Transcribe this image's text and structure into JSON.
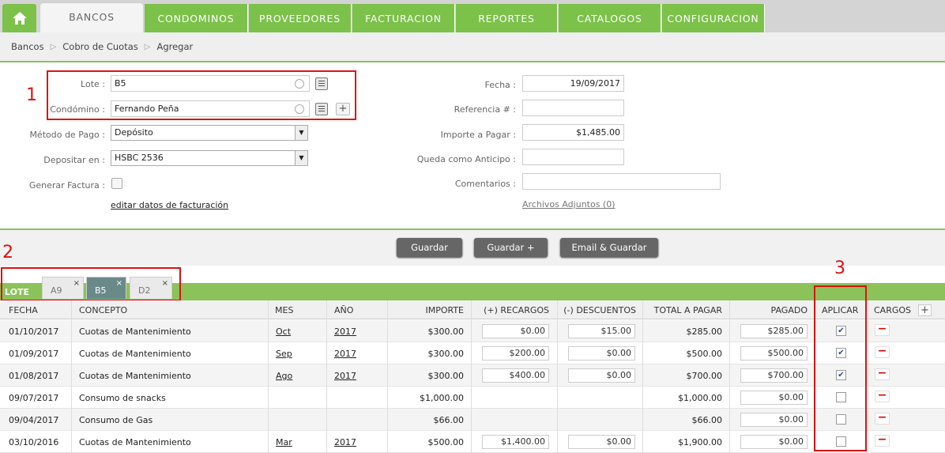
{
  "nav": {
    "tabs": [
      "BANCOS",
      "CONDOMINOS",
      "PROVEEDORES",
      "FACTURACION",
      "REPORTES",
      "CATALOGOS",
      "CONFIGURACION"
    ]
  },
  "breadcrumb": [
    "Bancos",
    "Cobro de Cuotas",
    "Agregar"
  ],
  "form": {
    "lote_label": "Lote :",
    "lote_value": "B5",
    "condomino_label": "Condómino :",
    "condomino_value": "Fernando Peña",
    "metodo_label": "Método de Pago :",
    "metodo_value": "Depósito",
    "depositar_label": "Depositar en :",
    "depositar_value": "HSBC 2536",
    "factura_label": "Generar Factura :",
    "facturacion_link": "editar datos de facturación",
    "fecha_label": "Fecha :",
    "fecha_value": "19/09/2017",
    "referencia_label": "Referencia # :",
    "referencia_value": "",
    "importe_label": "Importe a Pagar :",
    "importe_value": "$1,485.00",
    "anticipo_label": "Queda como Anticipo :",
    "anticipo_value": "",
    "comentarios_label": "Comentarios :",
    "comentarios_value": "",
    "adjuntos_link": "Archivos Adjuntos (0)"
  },
  "annotations": {
    "one": "1",
    "two": "2",
    "three": "3"
  },
  "buttons": {
    "guardar": "Guardar",
    "guardar_plus": "Guardar +",
    "email_guardar": "Email & Guardar"
  },
  "lote_tabs": {
    "label": "LOTE",
    "tabs": [
      "A9",
      "B5",
      "D2"
    ],
    "close": "×"
  },
  "table": {
    "headers": {
      "fecha": "FECHA",
      "concepto": "CONCEPTO",
      "mes": "MES",
      "anio": "AÑO",
      "importe": "IMPORTE",
      "recargos": "(+) RECARGOS",
      "descuentos": "(-) DESCUENTOS",
      "total": "TOTAL A PAGAR",
      "pagado": "PAGADO",
      "aplicar": "APLICAR",
      "cargos": "CARGOS"
    },
    "rows": [
      {
        "fecha": "01/10/2017",
        "concepto": "Cuotas de Mantenimiento",
        "mes": "Oct",
        "anio": "2017",
        "importe": "$300.00",
        "recargos": "$0.00",
        "descuentos": "$15.00",
        "total": "$285.00",
        "pagado": "$285.00",
        "aplicar": true
      },
      {
        "fecha": "01/09/2017",
        "concepto": "Cuotas de Mantenimiento",
        "mes": "Sep",
        "anio": "2017",
        "importe": "$300.00",
        "recargos": "$200.00",
        "descuentos": "$0.00",
        "total": "$500.00",
        "pagado": "$500.00",
        "aplicar": true
      },
      {
        "fecha": "01/08/2017",
        "concepto": "Cuotas de Mantenimiento",
        "mes": "Ago",
        "anio": "2017",
        "importe": "$300.00",
        "recargos": "$400.00",
        "descuentos": "$0.00",
        "total": "$700.00",
        "pagado": "$700.00",
        "aplicar": true
      },
      {
        "fecha": "09/07/2017",
        "concepto": "Consumo de snacks",
        "mes": "",
        "anio": "",
        "importe": "$1,000.00",
        "recargos": "",
        "descuentos": "",
        "total": "$1,000.00",
        "pagado": "$0.00",
        "aplicar": false
      },
      {
        "fecha": "09/04/2017",
        "concepto": "Consumo de Gas",
        "mes": "",
        "anio": "",
        "importe": "$66.00",
        "recargos": "",
        "descuentos": "",
        "total": "$66.00",
        "pagado": "$0.00",
        "aplicar": false
      },
      {
        "fecha": "03/10/2016",
        "concepto": "Cuotas de Mantenimiento",
        "mes": "Mar",
        "anio": "2017",
        "importe": "$500.00",
        "recargos": "$1,400.00",
        "descuentos": "$0.00",
        "total": "$1,900.00",
        "pagado": "$0.00",
        "aplicar": false
      }
    ]
  },
  "colors": {
    "green": "#7cc14a",
    "annotation_red": "#dd1111",
    "button": "#666666"
  }
}
